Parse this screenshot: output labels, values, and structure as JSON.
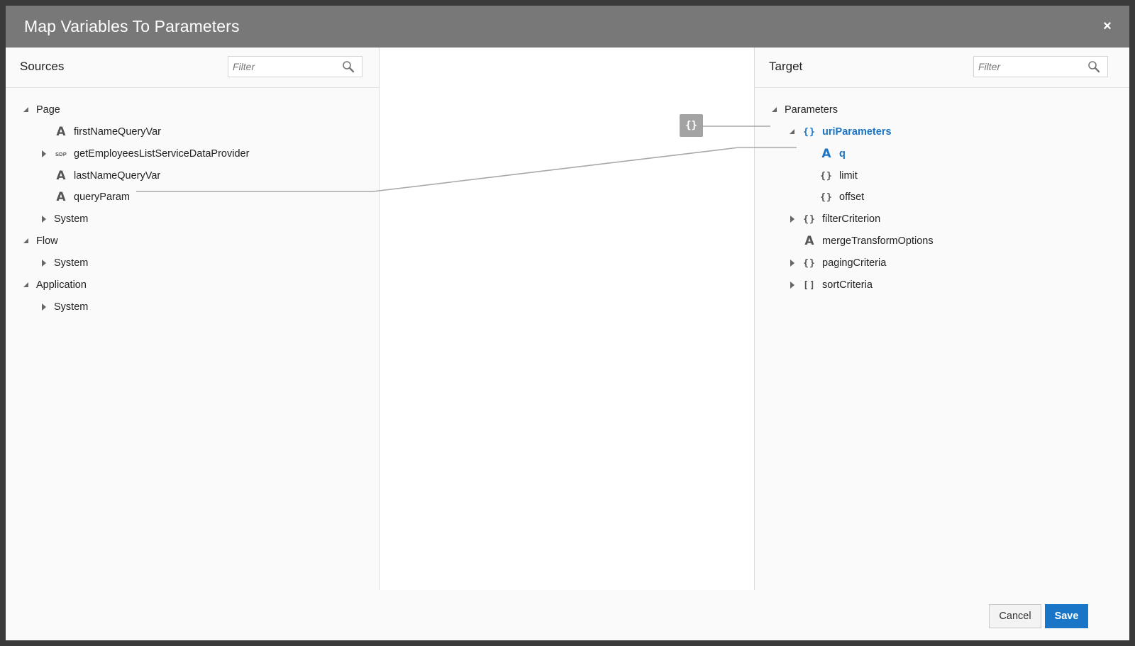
{
  "dialog": {
    "title": "Map Variables To Parameters",
    "close_label": "×"
  },
  "sources": {
    "header": "Sources",
    "filter_placeholder": "Filter",
    "tree": [
      {
        "label": "Page",
        "state": "expanded"
      },
      {
        "label": "firstNameQueryVar",
        "type_icon": "string-icon",
        "glyph": "A"
      },
      {
        "label": "getEmployeesListServiceDataProvider",
        "state": "collapsed",
        "type_icon": "sdp-icon",
        "glyph": "SDP"
      },
      {
        "label": "lastNameQueryVar",
        "type_icon": "string-icon",
        "glyph": "A"
      },
      {
        "label": "queryParam",
        "type_icon": "string-icon",
        "glyph": "A",
        "mapped": true
      },
      {
        "label": "System",
        "state": "collapsed"
      },
      {
        "label": "Flow",
        "state": "expanded"
      },
      {
        "label": "System",
        "state": "collapsed"
      },
      {
        "label": "Application",
        "state": "expanded"
      },
      {
        "label": "System",
        "state": "collapsed"
      }
    ]
  },
  "target": {
    "header": "Target",
    "filter_placeholder": "Filter",
    "tree": [
      {
        "label": "Parameters",
        "state": "expanded"
      },
      {
        "label": "uriParameters",
        "state": "expanded",
        "type_icon": "object-icon",
        "glyph": "{}",
        "selected": true
      },
      {
        "label": "q",
        "type_icon": "string-icon",
        "glyph": "A",
        "selected": true
      },
      {
        "label": "limit",
        "type_icon": "object-icon",
        "glyph": "{}"
      },
      {
        "label": "offset",
        "type_icon": "object-icon",
        "glyph": "{}"
      },
      {
        "label": "filterCriterion",
        "state": "collapsed",
        "type_icon": "object-icon",
        "glyph": "{}"
      },
      {
        "label": "mergeTransformOptions",
        "type_icon": "string-icon",
        "glyph": "A"
      },
      {
        "label": "pagingCriteria",
        "state": "collapsed",
        "type_icon": "object-icon",
        "glyph": "{}"
      },
      {
        "label": "sortCriteria",
        "state": "collapsed",
        "type_icon": "array-icon",
        "glyph": "[]"
      }
    ]
  },
  "mapping": {
    "object_badge_glyph": "{}",
    "line_color": "#a8a8a8"
  },
  "footer": {
    "cancel_label": "Cancel",
    "save_label": "Save"
  },
  "colors": {
    "titlebar": "#787878",
    "accent": "#1976c6",
    "selected_text": "#1b73c4"
  }
}
